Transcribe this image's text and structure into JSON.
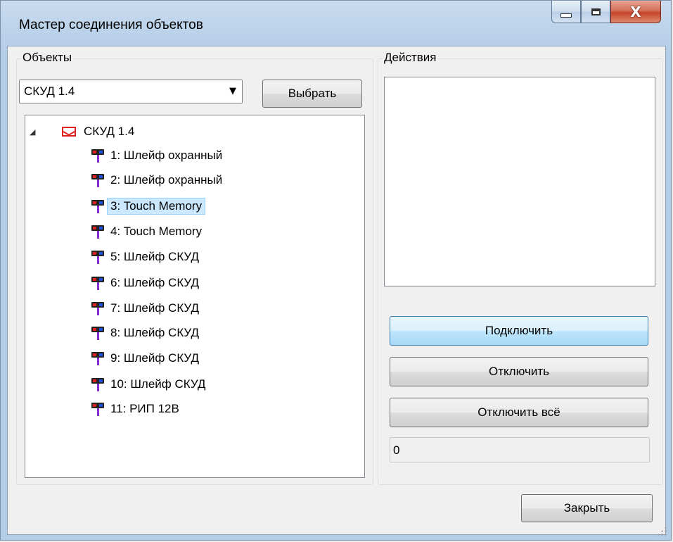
{
  "window": {
    "title": "Мастер соединения объектов",
    "close_glyph": "X",
    "max_glyph": "",
    "min_glyph": ""
  },
  "objects_group": {
    "label": "Объекты",
    "combo_value": "СКУД 1.4",
    "combo_arrow": "▼",
    "select_button": "Выбрать",
    "tree": {
      "root": {
        "label": "СКУД 1.4",
        "icon": "device-icon",
        "expanded": true,
        "expander_glyph": "◢"
      },
      "children": [
        {
          "label": "1: Шлейф охранный",
          "icon": "port-icon"
        },
        {
          "label": "2: Шлейф охранный",
          "icon": "port-icon"
        },
        {
          "label": "3: Touch Memory",
          "icon": "port-icon",
          "selected": true
        },
        {
          "label": "4: Touch Memory",
          "icon": "port-icon"
        },
        {
          "label": "5: Шлейф СКУД",
          "icon": "port-icon"
        },
        {
          "label": "6: Шлейф СКУД",
          "icon": "port-icon"
        },
        {
          "label": "7: Шлейф СКУД",
          "icon": "port-icon"
        },
        {
          "label": "8: Шлейф СКУД",
          "icon": "port-icon"
        },
        {
          "label": "9: Шлейф СКУД",
          "icon": "port-icon"
        },
        {
          "label": "10: Шлейф СКУД",
          "icon": "port-icon"
        },
        {
          "label": "11: РИП 12В",
          "icon": "port-icon"
        }
      ]
    }
  },
  "actions_group": {
    "label": "Действия",
    "connect_button": "Подключить",
    "disconnect_button": "Отключить",
    "disconnect_all_button": "Отключить всё",
    "status_value": "0"
  },
  "footer": {
    "close_button": "Закрыть"
  },
  "colors": {
    "selection": "#cce8ff",
    "hot_button": "#bee6fd",
    "close_red": "#c4442a"
  }
}
